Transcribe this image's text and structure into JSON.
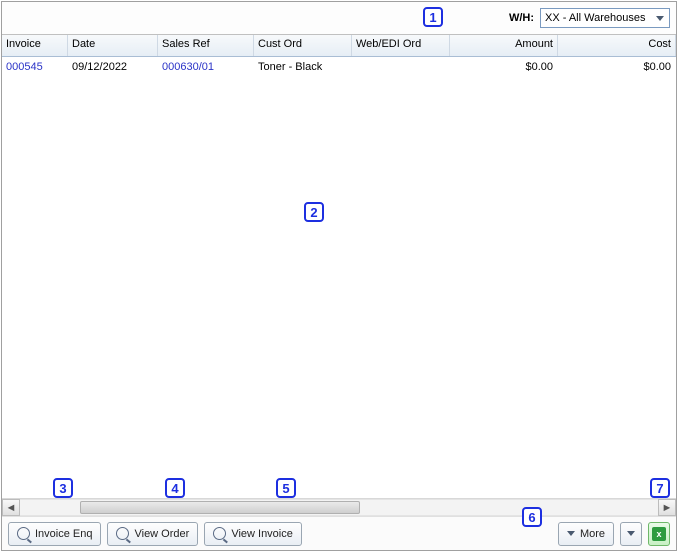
{
  "topbar": {
    "wh_label": "W/H:",
    "wh_selected": "XX - All Warehouses"
  },
  "grid": {
    "columns": {
      "invoice": "Invoice",
      "date": "Date",
      "sales_ref": "Sales Ref",
      "cust_ord": "Cust Ord",
      "web_edi": "Web/EDI Ord",
      "amount": "Amount",
      "cost": "Cost"
    },
    "rows": [
      {
        "invoice": "000545",
        "date": "09/12/2022",
        "sales_ref": "000630/01",
        "cust_ord": "Toner - Black",
        "web_edi": "",
        "amount": "$0.00",
        "cost": "$0.00"
      }
    ]
  },
  "buttons": {
    "invoice_enq": "Invoice Enq",
    "view_order": "View Order",
    "view_invoice": "View Invoice",
    "more": "More"
  },
  "annotations": [
    "1",
    "2",
    "3",
    "4",
    "5",
    "6",
    "7"
  ],
  "colors": {
    "annotation_border": "#1d2fe0",
    "link": "#2a33c7"
  }
}
